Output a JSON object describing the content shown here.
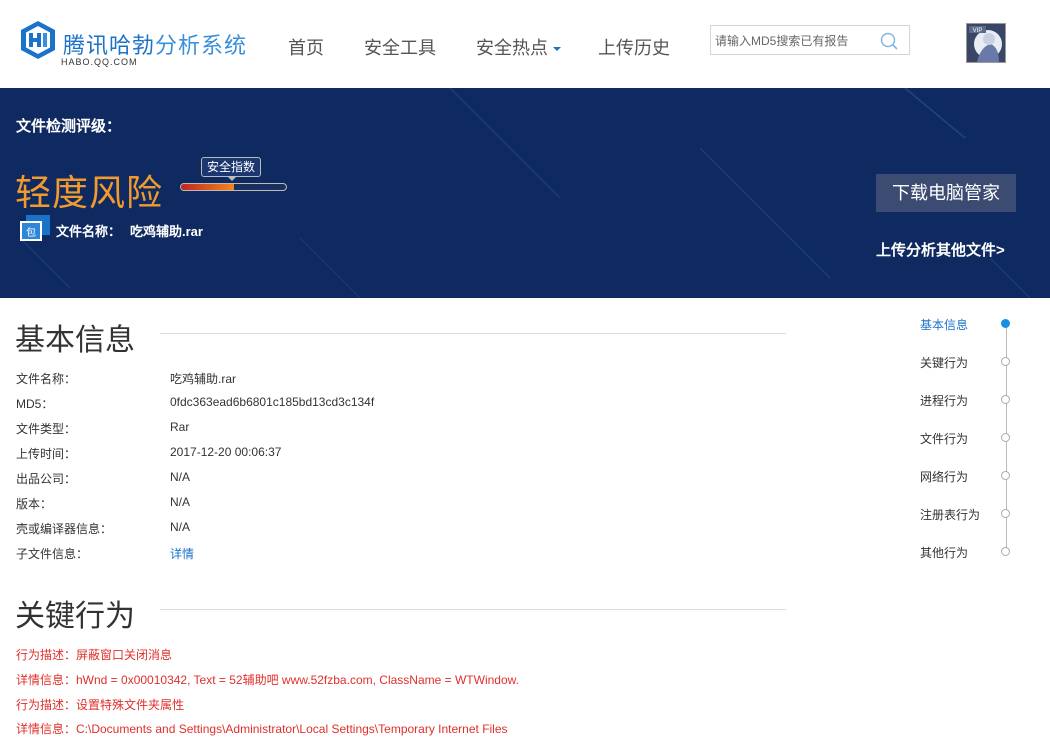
{
  "header": {
    "brand_main": "腾讯哈勃",
    "brand_sub": "分析系统",
    "domain": "HABO.QQ.COM",
    "nav": [
      {
        "label": "首页"
      },
      {
        "label": "安全工具"
      },
      {
        "label": "安全热点",
        "has_dropdown": true
      },
      {
        "label": "上传历史"
      }
    ],
    "search_placeholder": "请输入MD5搜索已有报告",
    "avatar_badge": "VIP"
  },
  "banner": {
    "rating_label": "文件检测评级：",
    "risk_level": "轻度风险",
    "index_tag": "安全指数",
    "index_level": 0.5,
    "file_icon_text": "包",
    "file_name_label": "文件名称：",
    "file_name": "吃鸡辅助.rar",
    "download_button": "下载电脑管家",
    "upload_link": "上传分析其他文件>"
  },
  "basic_info": {
    "title": "基本信息",
    "rows": [
      {
        "label": "文件名称：",
        "value": "吃鸡辅助.rar"
      },
      {
        "label": "MD5：",
        "value": "0fdc363ead6b6801c185bd13cd3c134f"
      },
      {
        "label": "文件类型：",
        "value": "Rar"
      },
      {
        "label": "上传时间：",
        "value": "2017-12-20 00:06:37"
      },
      {
        "label": "出品公司：",
        "value": "N/A"
      },
      {
        "label": "版本：",
        "value": "N/A"
      },
      {
        "label": "壳或编译器信息：",
        "value": "N/A"
      },
      {
        "label": "子文件信息：",
        "value": "详情",
        "link": true
      }
    ]
  },
  "key_behavior": {
    "title": "关键行为",
    "lines": [
      "行为描述：屏蔽窗口关闭消息",
      "详情信息：hWnd = 0x00010342, Text = 52辅助吧 www.52fzba.com, ClassName = WTWindow.",
      "行为描述：设置特殊文件夹属性",
      "详情信息：C:\\Documents and Settings\\Administrator\\Local Settings\\Temporary Internet Files"
    ]
  },
  "side_nav": {
    "items": [
      {
        "label": "基本信息",
        "active": true
      },
      {
        "label": "关键行为"
      },
      {
        "label": "进程行为"
      },
      {
        "label": "文件行为"
      },
      {
        "label": "网络行为"
      },
      {
        "label": "注册表行为"
      },
      {
        "label": "其他行为"
      }
    ]
  },
  "colors": {
    "accent": "#1a73c9",
    "banner_bg": "#0f2a60",
    "risk": "#f39a2f",
    "behavior_text": "#e0302b"
  }
}
